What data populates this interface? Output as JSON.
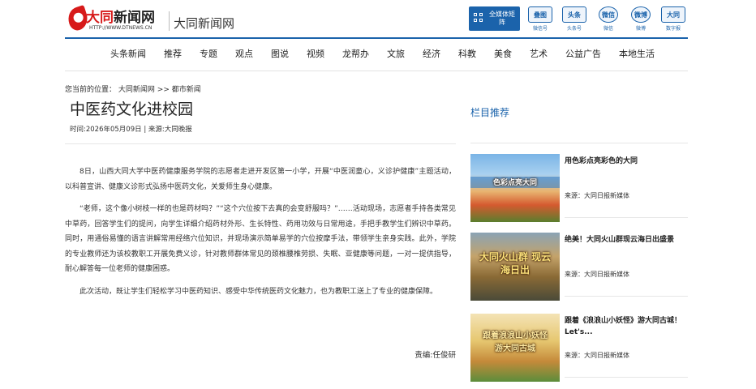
{
  "header": {
    "logo_text_red": "大同",
    "logo_text_black": "新闻网",
    "logo_url": "HTTP://WWW.DTNEWS.CN",
    "site_name": "大同新闻网",
    "matrix_label": "全媒体矩阵",
    "social": [
      {
        "icon": "duotu-icon",
        "glyph": "叠图",
        "caption": "微信号"
      },
      {
        "icon": "toutiao-icon",
        "glyph": "头条",
        "caption": "头条号"
      },
      {
        "icon": "wechat-icon",
        "glyph": "微信",
        "caption": "微信"
      },
      {
        "icon": "weibo-icon",
        "glyph": "微博",
        "caption": "微博"
      },
      {
        "icon": "datong-icon",
        "glyph": "大同",
        "caption": "数字报"
      }
    ],
    "accent_color": "#1b63ab",
    "brand_red": "#d71a1a"
  },
  "nav": {
    "items": [
      "头条新闻",
      "推荐",
      "专题",
      "观点",
      "图说",
      "视频",
      "龙帮办",
      "文旅",
      "经济",
      "科教",
      "美食",
      "艺术",
      "公益广告",
      "本地生活"
    ]
  },
  "breadcrumb": {
    "prefix": "您当前的位置：",
    "home": "大同新闻网",
    "separator": ">>",
    "current": "都市新闻"
  },
  "article": {
    "title": "中医药文化进校园",
    "meta": "时间:2026年05月09日 | 来源:大同晚报",
    "paragraphs": [
      "8日，山西大同大学中医药健康服务学院的志愿者走进开发区第一小学，开展“中医润童心，义诊护健康”主题活动，以科普宣讲、健康义诊形式弘扬中医药文化，关爱师生身心健康。",
      "“老师，这个像小树枝一样的也是药材吗？”“这个穴位按下去真的会变舒服吗？”……活动现场，志愿者手持各类常见中草药，回答学生们的提问，向学生详细介绍药材外形、生长特性、药用功效与日常用途，手把手教学生们辨识中草药。同时，用通俗易懂的语言讲解常用经络穴位知识，并现场演示简单易学的穴位按摩手法，带领学生亲身实践。此外，学院的专业教师还为该校教职工开展免费义诊，针对教师群体常见的颈椎腰椎劳损、失眠、亚健康等问题，一对一提供指导，耐心解答每一位老师的健康困惑。",
      "此次活动，既让学生们轻松学习中医药知识、感受中华传统医药文化魅力，也为教职工送上了专业的健康保障。"
    ],
    "editor": "责编:任俊研"
  },
  "sidebar": {
    "title": "栏目推荐",
    "items": [
      {
        "title": "用色彩点亮彩色的大同",
        "source": "来源：大同日报新媒体",
        "thumb_text": "色彩点亮大同"
      },
      {
        "title": "绝美！大同火山群现云海日出盛景",
        "source": "来源：大同日报新媒体",
        "thumb_text": "大同火山群 现云海日出"
      },
      {
        "title": "跟着《浪浪山小妖怪》游大同古城！Let's...",
        "source": "来源：大同日报新媒体",
        "thumb_text": "跟着浪浪山小妖怪 游大同古城"
      }
    ]
  }
}
